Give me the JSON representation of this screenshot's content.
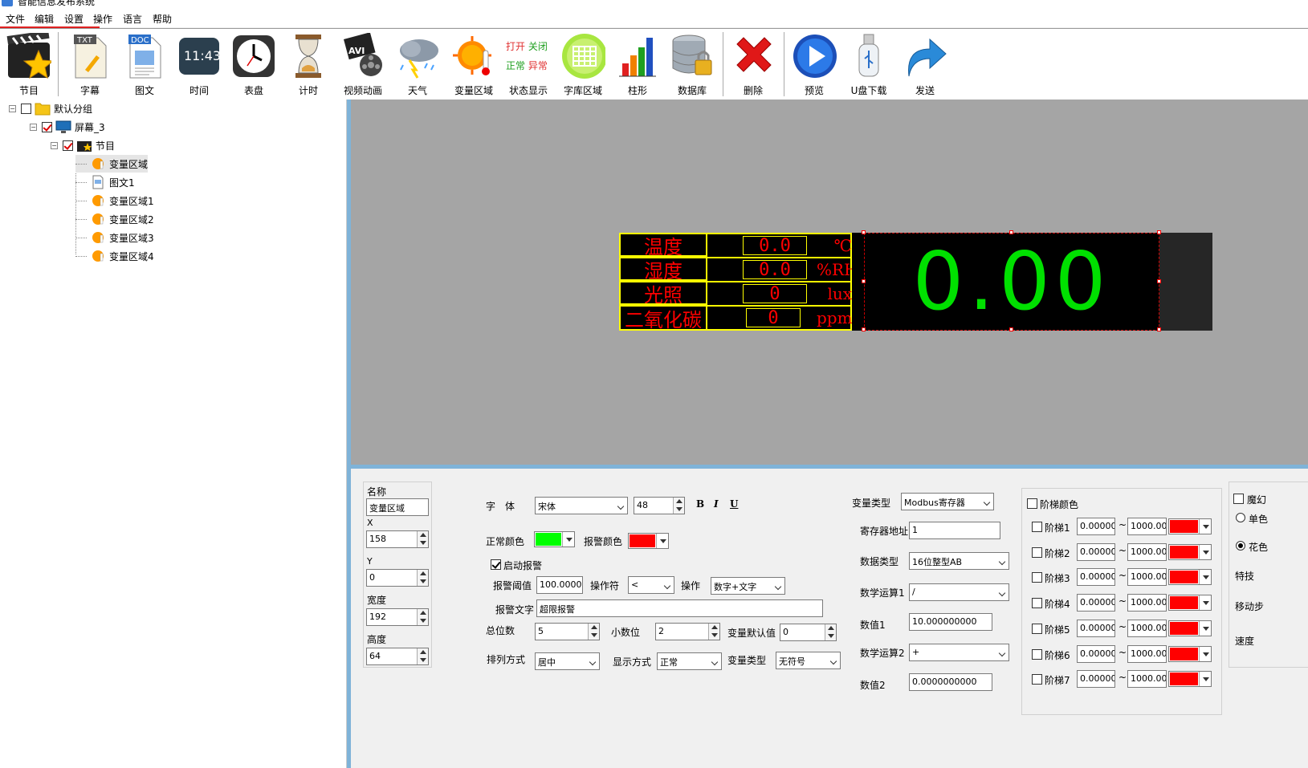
{
  "title": "智能信息发布系统",
  "menu": [
    "文件",
    "编辑",
    "设置",
    "操作",
    "语言",
    "帮助"
  ],
  "toolbar": [
    "节目",
    "字幕",
    "图文",
    "时间",
    "表盘",
    "计时",
    "视频动画",
    "天气",
    "变量区域",
    "状态显示",
    "字库区域",
    "柱形",
    "数据库",
    "删除",
    "预览",
    "U盘下载",
    "发送"
  ],
  "toolbar_icon_text": {
    "txt": "TXT",
    "doc": "DOC",
    "clock": "11:43",
    "avi": "AVI",
    "state": [
      "打开",
      "关闭",
      "正常",
      "异常"
    ]
  },
  "tree": {
    "root": "默认分组",
    "screen": "屏幕_3",
    "program": "节目",
    "items": [
      "变量区域",
      "图文1",
      "变量区域1",
      "变量区域2",
      "变量区域3",
      "变量区域4"
    ]
  },
  "preview": {
    "rows": [
      {
        "label": "温度",
        "value": "0.0",
        "unit": "℃"
      },
      {
        "label": "湿度",
        "value": "0.0",
        "unit": "%RH"
      },
      {
        "label": "光照",
        "value": "0",
        "unit": "lux"
      },
      {
        "label": "二氧化碳",
        "value": "0",
        "unit": "ppm"
      }
    ],
    "big_value": "0.00",
    "colors": {
      "label": "#ff0000",
      "border": "#ffff00",
      "big": "#00e000",
      "bg": "#000000"
    }
  },
  "props": {
    "name_label": "名称",
    "name_value": "变量区域",
    "x_label": "X",
    "x_value": "158",
    "y_label": "Y",
    "y_value": "0",
    "w_label": "宽度",
    "w_value": "192",
    "h_label": "高度",
    "h_value": "64",
    "font_label": "字　体",
    "font_value": "宋体",
    "font_size": "48",
    "bold": "B",
    "italic": "I",
    "underline": "U",
    "normal_color_label": "正常颜色",
    "normal_color": "#00ff00",
    "alarm_color_label": "报警颜色",
    "alarm_color": "#ff0000",
    "enable_alarm_label": "启动报警",
    "alarm_threshold_label": "报警阈值",
    "alarm_threshold_value": "100.000000",
    "operator_label": "操作符",
    "operator_value": "<",
    "operation_label": "操作",
    "operation_value": "数字+文字",
    "alarm_text_label": "报警文字",
    "alarm_text_value": "超限报警",
    "total_digits_label": "总位数",
    "total_digits_value": "5",
    "decimals_label": "小数位",
    "decimals_value": "2",
    "var_default_label": "变量默认值",
    "var_default_value": "0",
    "align_label": "排列方式",
    "align_value": "居中",
    "display_label": "显示方式",
    "display_value": "正常",
    "var_type2_label": "变量类型",
    "var_type2_value": "无符号",
    "var_type_label": "变量类型",
    "var_type_value": "Modbus寄存器",
    "reg_addr_label": "寄存器地址",
    "reg_addr_value": "1",
    "data_type_label": "数据类型",
    "data_type_value": "16位整型AB",
    "op1_label": "数学运算1",
    "op1_value": "/",
    "num1_label": "数值1",
    "num1_value": "10.000000000",
    "op2_label": "数学运算2",
    "op2_value": "+",
    "num2_label": "数值2",
    "num2_value": "0.0000000000",
    "ladder_label": "阶梯颜色",
    "ladders": [
      {
        "label": "阶梯1",
        "min": "0.00000",
        "max": "1000.000"
      },
      {
        "label": "阶梯2",
        "min": "0.00000",
        "max": "1000.000"
      },
      {
        "label": "阶梯3",
        "min": "0.00000",
        "max": "1000.000"
      },
      {
        "label": "阶梯4",
        "min": "0.00000",
        "max": "1000.000"
      },
      {
        "label": "阶梯5",
        "min": "0.00000",
        "max": "1000.000"
      },
      {
        "label": "阶梯6",
        "min": "0.00000",
        "max": "1000.000"
      },
      {
        "label": "阶梯7",
        "min": "0.00000",
        "max": "1000.000"
      }
    ],
    "tilde": "~",
    "ladder_color": "#ff0000",
    "far_right": {
      "check": "魔幻",
      "radio1": "单色",
      "radio2": "花色",
      "effect": "特技",
      "move": "移动步",
      "speed": "速度"
    }
  }
}
